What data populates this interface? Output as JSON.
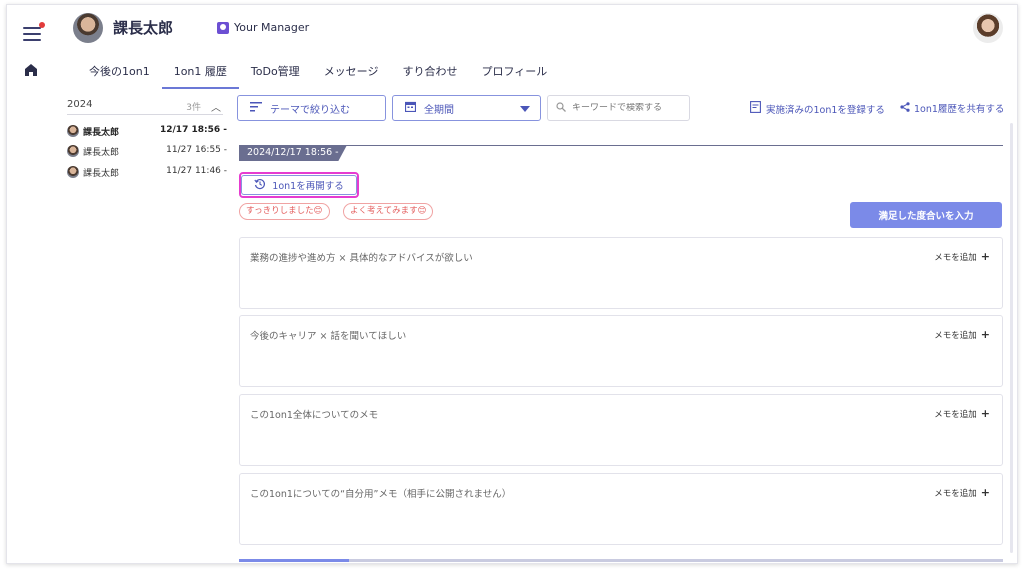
{
  "header": {
    "user_name": "課長太郎",
    "role_label": "Your Manager"
  },
  "tabs": [
    {
      "label": "今後の1on1"
    },
    {
      "label": "1on1 履歴"
    },
    {
      "label": "ToDo管理"
    },
    {
      "label": "メッセージ"
    },
    {
      "label": "すり合わせ"
    },
    {
      "label": "プロフィール"
    }
  ],
  "history": {
    "year": "2024",
    "count": "3件",
    "items": [
      {
        "name": "課長太郎",
        "time": "12/17 18:56 -"
      },
      {
        "name": "課長太郎",
        "time": "11/27 16:55 -"
      },
      {
        "name": "課長太郎",
        "time": "11/27 11:46 -"
      }
    ]
  },
  "toolbar": {
    "filter_label": "テーマで絞り込む",
    "period_label": "全期間",
    "search_placeholder": "キーワードで検索する",
    "register_label": "実施済みの1on1を登録する",
    "share_label": "1on1履歴を共有する"
  },
  "session": {
    "date": "2024/12/17 18:56 -",
    "resume_label": "1on1を再開する",
    "tags": [
      "すっきりしました😊",
      "よく考えてみます😊"
    ],
    "satisfaction_label": "満足した度合いを入力"
  },
  "memos": [
    {
      "title": "業務の進捗や進め方 × 具体的なアドバイスが欲しい",
      "add_label": "メモを追加"
    },
    {
      "title": "今後のキャリア × 話を聞いてほしい",
      "add_label": "メモを追加"
    },
    {
      "title": "この1on1全体についてのメモ",
      "add_label": "メモを追加"
    },
    {
      "title": "この1on1についての“自分用”メモ（相手に公開されません）",
      "add_label": "メモを追加"
    }
  ],
  "colors": {
    "accent": "#7b8ae8",
    "highlight": "#e63bd0",
    "tag": "#e35d5d"
  }
}
